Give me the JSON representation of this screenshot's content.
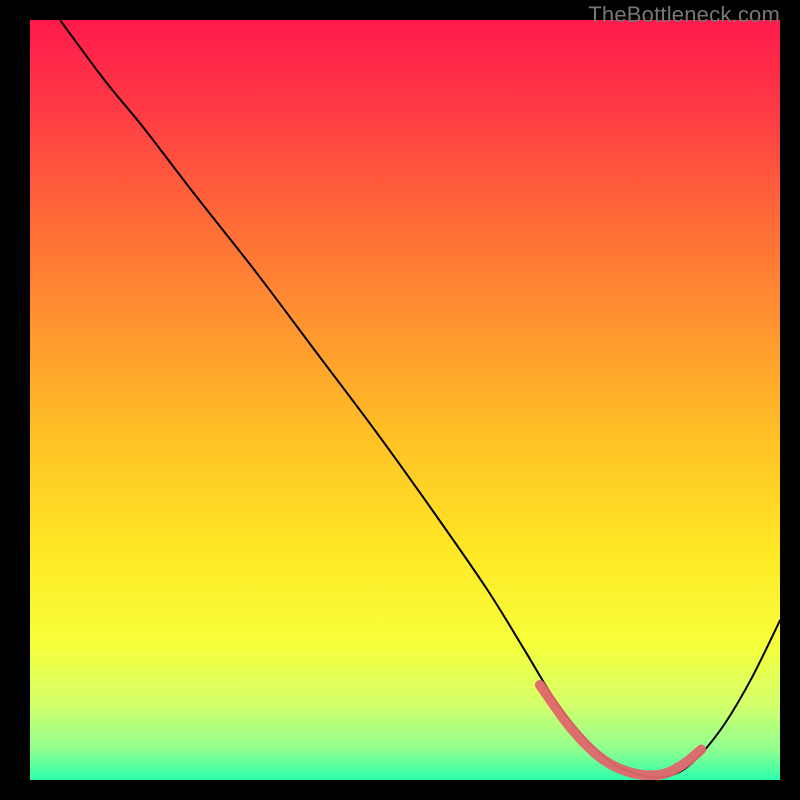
{
  "watermark": "TheBottleneck.com",
  "chart_data": {
    "type": "line",
    "title": "",
    "xlabel": "",
    "ylabel": "",
    "xlim": [
      0,
      100
    ],
    "ylim": [
      0,
      100
    ],
    "background_gradient": {
      "stops": [
        {
          "offset": 0.0,
          "color": "#ff1a4b"
        },
        {
          "offset": 0.12,
          "color": "#ff3b45"
        },
        {
          "offset": 0.25,
          "color": "#ff6638"
        },
        {
          "offset": 0.4,
          "color": "#ff9430"
        },
        {
          "offset": 0.55,
          "color": "#ffc125"
        },
        {
          "offset": 0.7,
          "color": "#ffe825"
        },
        {
          "offset": 0.82,
          "color": "#f7ff3a"
        },
        {
          "offset": 0.9,
          "color": "#d4ff6a"
        },
        {
          "offset": 0.96,
          "color": "#8fff90"
        },
        {
          "offset": 1.0,
          "color": "#2cffad"
        }
      ]
    },
    "series": [
      {
        "name": "bottleneck-curve",
        "stroke": "#000000",
        "stroke_width": 2,
        "x": [
          4.0,
          10.0,
          15.0,
          22.0,
          30.0,
          38.0,
          46.0,
          54.0,
          61.0,
          66.0,
          70.0,
          74.0,
          78.0,
          82.0,
          85.0,
          88.0,
          92.0,
          96.0,
          100.0
        ],
        "y": [
          100.0,
          92.0,
          86.0,
          77.0,
          67.0,
          56.5,
          46.0,
          35.0,
          25.0,
          17.0,
          10.5,
          5.5,
          2.0,
          0.5,
          0.5,
          2.0,
          6.5,
          13.0,
          21.0
        ]
      },
      {
        "name": "optimal-band",
        "stroke": "#e0666b",
        "stroke_width": 10,
        "linecap": "round",
        "x": [
          68.0,
          72.0,
          76.0,
          80.0,
          84.0,
          87.0,
          89.5
        ],
        "y": [
          12.5,
          7.0,
          3.0,
          1.0,
          0.7,
          2.0,
          4.0
        ]
      }
    ]
  }
}
